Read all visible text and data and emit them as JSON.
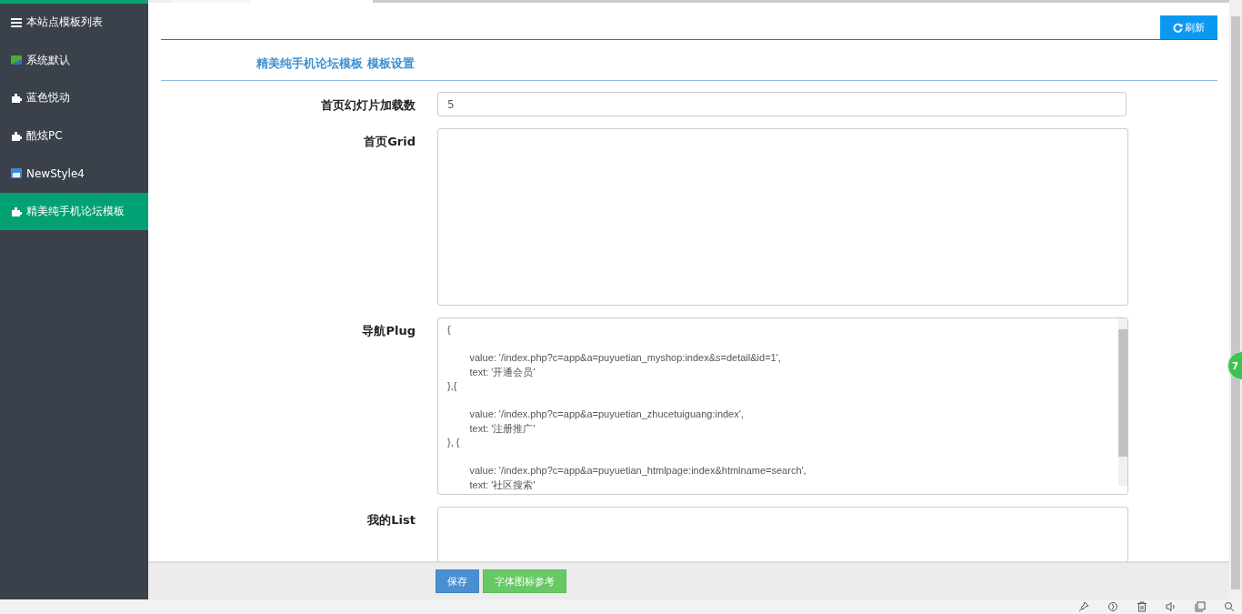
{
  "sidebar": {
    "items": [
      {
        "label": "本站点模板列表",
        "kind": "list",
        "selected": false
      },
      {
        "label": "系统默认",
        "kind": "image",
        "selected": false
      },
      {
        "label": "蓝色悦动",
        "kind": "plugin",
        "selected": false
      },
      {
        "label": "酷炫PC",
        "kind": "plugin",
        "selected": false
      },
      {
        "label": "NewStyle4",
        "kind": "photo",
        "selected": false
      },
      {
        "label": "精美纯手机论坛模板",
        "kind": "plugin",
        "selected": true
      }
    ]
  },
  "toolbar": {
    "refresh_button": "刷新"
  },
  "title": "精美纯手机论坛模板 模板设置",
  "fields": [
    {
      "label": "首页幻灯片加载数",
      "kind": "input",
      "value": "5"
    },
    {
      "label": "首页Grid",
      "kind": "textarea"
    },
    {
      "label": "导航Plug",
      "kind": "textarea",
      "value": "{\n\n        value: '/index.php?c=app&a=puyuetian_myshop:index&s=detail&id=1',\n        text: '开通会员'\n},{\n\n        value: '/index.php?c=app&a=puyuetian_zhucetuiguang:index',\n        text: '注册推广'\n}, {\n\n        value: '/index.php?c=app&a=puyuetian_htmlpage:index&htmlname=search',\n        text: '社区搜索'"
    },
    {
      "label": "我的List",
      "kind": "textarea"
    }
  ],
  "footer": {
    "buttons": [
      {
        "label": "保存",
        "kind": "primary"
      },
      {
        "label": "字体图标参考",
        "kind": "success"
      }
    ]
  },
  "floating_badge": "7"
}
